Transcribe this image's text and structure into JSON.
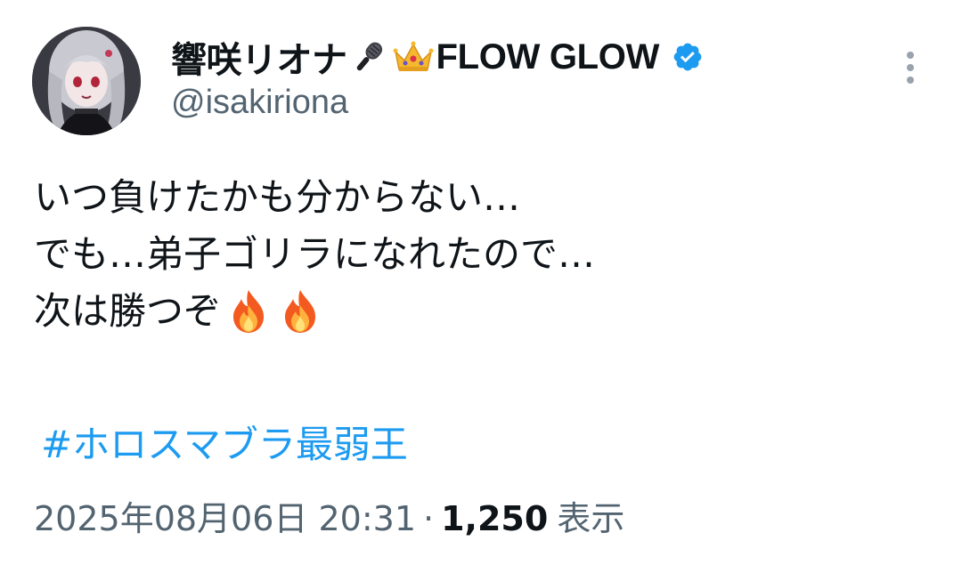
{
  "author": {
    "display_name": "響咲リオナ",
    "name_emojis": [
      "microphone-emoji",
      "crown-emoji"
    ],
    "brand": "FLOW GLOW",
    "handle": "@isakiriona",
    "verified": true,
    "verified_color": "#1d9bf0"
  },
  "tweet": {
    "lines": [
      "いつ負けたかも分からない…",
      "でも…弟子ゴリラになれたので…",
      "次は勝つぞ"
    ],
    "line3_emojis": [
      "fire-emoji",
      "fire-emoji"
    ],
    "hashtag": "#ホロスマブラ最弱王",
    "hashtag_color": "#1d9bf0"
  },
  "meta": {
    "timestamp": "2025年08月06日 20:31",
    "separator": "·",
    "views_count": "1,250",
    "views_label": "表示"
  },
  "icons": {
    "more_menu": "more-vertical-icon"
  }
}
